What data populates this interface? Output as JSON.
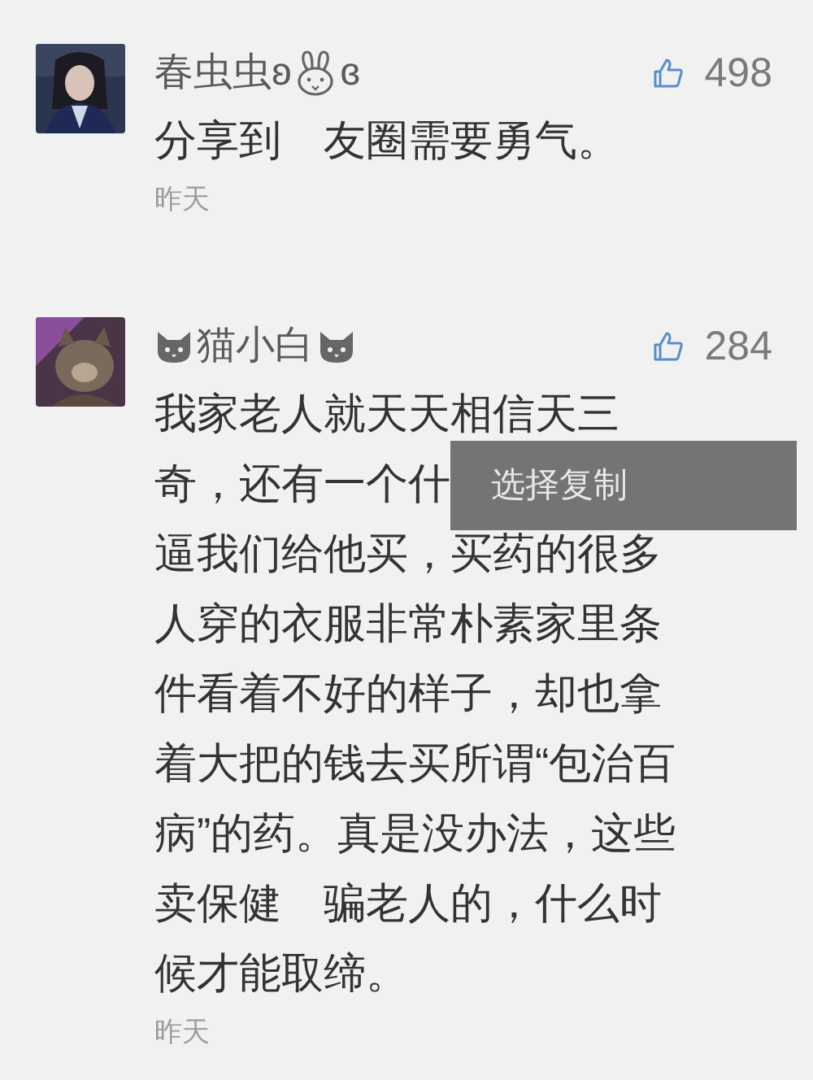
{
  "comments": [
    {
      "avatar": {
        "kind": "picture"
      },
      "name_parts": [
        {
          "kind": "text",
          "text": "春虫虫ʚ"
        },
        {
          "kind": "rabbit"
        },
        {
          "kind": "text",
          "text": "ɞ"
        }
      ],
      "likes": "498",
      "lines": [
        "分享到　友圈需要勇气。"
      ],
      "time": "昨天"
    },
    {
      "avatar": {
        "kind": "picture"
      },
      "name_parts": [
        {
          "kind": "cat"
        },
        {
          "kind": "text",
          "text": "猫小白"
        },
        {
          "kind": "cat"
        }
      ],
      "likes": "284",
      "lines": [
        "我家老人就天天相信天三",
        "奇，还有一个什",
        "逼我们给他买，买药的很多",
        "人穿的衣服非常朴素家里条",
        "件看着不好的样子，却也拿",
        "着大把的钱去买所谓“包治百",
        "病”的药。真是没办法，这些",
        "卖保健　骗老人的，什么时",
        "候才能取缔。"
      ],
      "time": "昨天"
    }
  ],
  "popup": {
    "label": "选择复制"
  }
}
